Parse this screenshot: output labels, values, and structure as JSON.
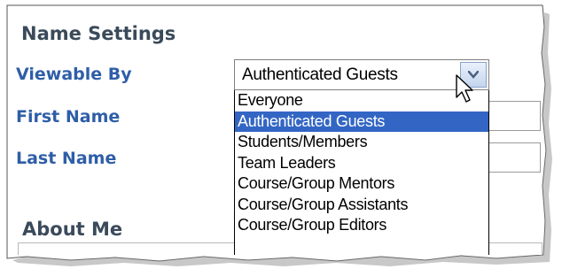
{
  "section": {
    "title": "Name Settings"
  },
  "fields": {
    "viewable_by": "Viewable By",
    "first_name": "First Name",
    "last_name": "Last Name"
  },
  "select": {
    "value": "Authenticated Guests",
    "options": [
      "Everyone",
      "Authenticated Guests",
      "Students/Members",
      "Team Leaders",
      "Course/Group Mentors",
      "Course/Group Assistants",
      "Course/Group Editors"
    ],
    "selected_index": 1
  },
  "about": {
    "title": "About Me"
  },
  "colors": {
    "label_blue": "#2f5ea8",
    "heading": "#3a4a5a",
    "highlight": "#3366c4"
  },
  "icons": {
    "dropdown": "chevron-down-icon",
    "cursor": "mouse-pointer-icon"
  }
}
